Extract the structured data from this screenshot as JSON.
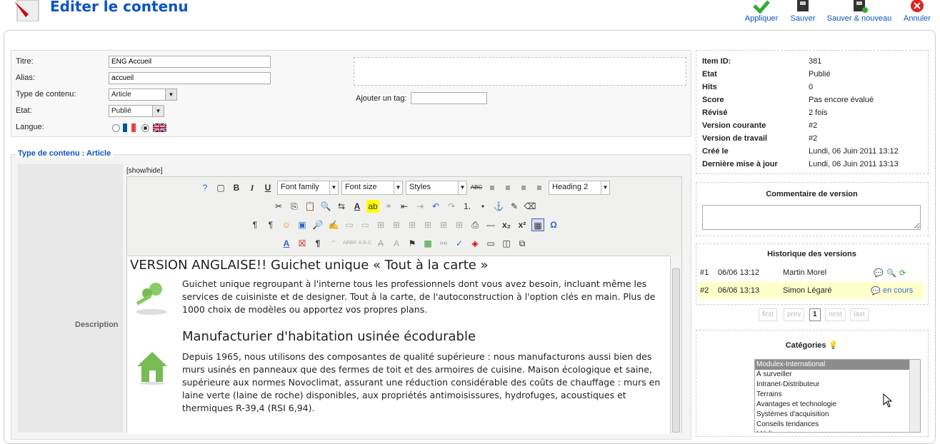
{
  "header": {
    "title": "Editer le contenu",
    "buttons": [
      {
        "label": "Appliquer",
        "icon": "check-icon"
      },
      {
        "label": "Sauver",
        "icon": "save-icon"
      },
      {
        "label": "Sauver & nouveau",
        "icon": "save-new-icon"
      },
      {
        "label": "Annuler",
        "icon": "cancel-icon"
      }
    ]
  },
  "meta": {
    "titre_label": "Titre:",
    "titre_value": "ENG Accueil",
    "alias_label": "Alias:",
    "alias_value": "accueil",
    "type_label": "Type de contenu:",
    "type_value": "Article",
    "etat_label": "Etat:",
    "etat_value": "Publié",
    "langue_label": "Langue:",
    "tag_label": "Ajouter un tag:"
  },
  "fieldset": {
    "legend": "Type de contenu : Article",
    "desc_label": "Description",
    "showhide": "[show/hide]"
  },
  "editor": {
    "font_family": "Font family",
    "font_size": "Font size",
    "styles": "Styles",
    "heading": "Heading 2",
    "h1": "VERSION ANGLAISE!!  Guichet unique « Tout à la carte »",
    "p1": "Guichet unique regroupant à l'interne tous les professionnels dont vous avez besoin, incluant même les services de cuisiniste et de designer. Tout à la carte, de l'autoconstruction à l'option clés en main. Plus de 1000 choix de modèles ou apportez vos propres plans.",
    "h2": "Manufacturier d'habitation usinée écodurable",
    "p2": "Depuis 1965, nous utilisons des composantes de qualité supérieure : nous manufacturons aussi bien des murs usinés en panneaux que des fermes de toit et des armoires de cuisine. Maison écologique et saine, supérieure aux normes Novoclimat, assurant une réduction considérable des coûts de chauffage : murs en laine verte (laine de roche) disponibles, aux propriétés antimoisissures, hydrofuges, acoustiques et thermiques R-39,4 (RSI 6,94)."
  },
  "info": [
    {
      "label": "Item ID:",
      "value": "381"
    },
    {
      "label": "Etat",
      "value": "Publié"
    },
    {
      "label": "Hits",
      "value": "0"
    },
    {
      "label": "Score",
      "value": "Pas encore évalué"
    },
    {
      "label": "Révisé",
      "value": "2 fois"
    },
    {
      "label": "Version courante",
      "value": "#2"
    },
    {
      "label": "Version de travail",
      "value": "#2"
    },
    {
      "label": "Créé le",
      "value": "Lundi, 06 Juin 2011 13:12"
    },
    {
      "label": "Dernière mise à jour",
      "value": "Lundi, 06 Juin 2011 13:13"
    }
  ],
  "comment_title": "Commentaire de version",
  "history": {
    "title": "Historique des versions",
    "rows": [
      {
        "num": "#1",
        "date": "06/06 13:12",
        "author": "Martin Morel",
        "status": ""
      },
      {
        "num": "#2",
        "date": "06/06 13:13",
        "author": "Simon Légaré",
        "status": "en cours"
      }
    ],
    "pager": [
      "first",
      "prev",
      "1",
      "next",
      "last"
    ]
  },
  "categories": {
    "title": "Catégories",
    "items": [
      "Modulex-International",
      "À surveiller",
      "Intranet-Distributeur",
      "Terrains",
      "Avantages et technologie",
      "Systèmes d'acquisition",
      "Conseils tendances",
      "Médias"
    ]
  },
  "colors": {
    "accent": "#0b55c4",
    "highlight_row": "#ffffcc",
    "selected_cat": "#8c8c8c"
  }
}
